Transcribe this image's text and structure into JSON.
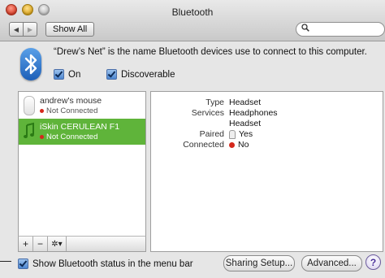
{
  "window": {
    "title": "Bluetooth"
  },
  "toolbar": {
    "back_icon": "◀",
    "forward_icon": "▶",
    "show_all_label": "Show All",
    "search_icon": "🔍",
    "search_placeholder": ""
  },
  "header": {
    "info_text": "“Drew’s Net” is the name Bluetooth devices use to connect to this computer.",
    "on_label": "On",
    "discoverable_label": "Discoverable"
  },
  "devices": [
    {
      "name": "andrew's mouse",
      "status": "Not Connected",
      "selected": false
    },
    {
      "name": "iSkin CERULEAN F1",
      "status": "Not Connected",
      "selected": true
    }
  ],
  "list_toolbar": {
    "add": "+",
    "remove": "−",
    "gear": "✲▾"
  },
  "details": [
    {
      "label": "Type",
      "value": "Headset"
    },
    {
      "label": "Services",
      "value": "Headphones"
    },
    {
      "label": "",
      "value": "Headset"
    },
    {
      "label": "Paired",
      "value": "Yes"
    },
    {
      "label": "Connected",
      "value": "No"
    }
  ],
  "footer": {
    "menu_bar_label": "Show Bluetooth status in the menu bar",
    "sharing_setup_label": "Sharing Setup...",
    "advanced_label": "Advanced...",
    "help_label": "?"
  },
  "colors": {
    "selected_row": "#5fb43a",
    "status_red": "#d5281c",
    "accent_blue": "#1d5fb8"
  }
}
